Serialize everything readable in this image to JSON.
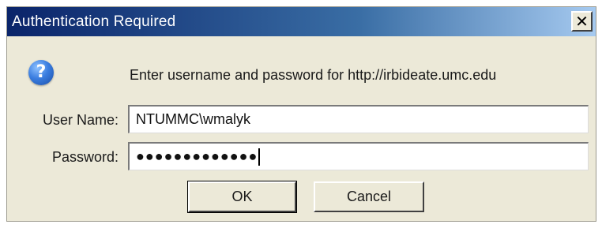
{
  "window": {
    "title": "Authentication Required",
    "close_label": "✕"
  },
  "icon": {
    "name": "question-icon",
    "glyph": "?"
  },
  "message": "Enter username and password for http://irbideate.umc.edu",
  "form": {
    "username_label": "User Name:",
    "username_value": "NTUMMC\\wmalyk",
    "password_label": "Password:",
    "password_value": "●●●●●●●●●●●●●"
  },
  "buttons": {
    "ok_label": "OK",
    "cancel_label": "Cancel"
  },
  "colors": {
    "titlebar_start": "#0a246a",
    "titlebar_end": "#a6caf0",
    "dialog_bg": "#ece9d8"
  }
}
